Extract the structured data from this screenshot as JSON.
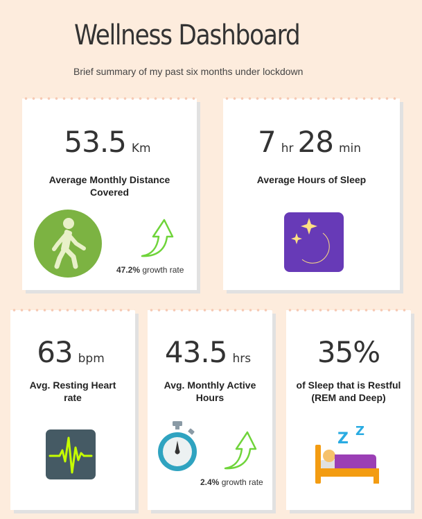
{
  "header": {
    "title": "Wellness Dashboard",
    "subtitle": "Brief summary of my past six months under lockdown"
  },
  "cards": {
    "distance": {
      "value": "53.5",
      "unit": "Km",
      "label": "Average Monthly Distance Covered",
      "growth_value": "47.2%",
      "growth_text": "growth rate",
      "icon": "walking-person-icon"
    },
    "sleep": {
      "value_hr": "7",
      "unit_hr": "hr",
      "value_min": "28",
      "unit_min": "min",
      "label": "Average Hours of Sleep",
      "icon": "moon-stars-icon"
    },
    "heart": {
      "value": "63",
      "unit": "bpm",
      "label": "Avg. Resting Heart rate",
      "icon": "heartbeat-monitor-icon"
    },
    "active": {
      "value": "43.5",
      "unit": "hrs",
      "label": "Avg. Monthly Active Hours",
      "growth_value": "2.4%",
      "growth_text": "growth rate",
      "icon": "stopwatch-icon"
    },
    "restful": {
      "value": "35%",
      "label": "of Sleep that is Restful (REM and Deep)",
      "icon": "sleeping-in-bed-icon"
    }
  },
  "colors": {
    "background": "#fdecdd",
    "arrow_green": "#6fd43a",
    "walk_green": "#7cb342",
    "moon_purple": "#673ab7",
    "moon_yellow": "#ffe082",
    "ecg_bg": "#455a64",
    "ecg_line": "#c6ff00",
    "stopwatch_blue": "#2fa3c0",
    "bed_orange": "#f39c12",
    "blanket_purple": "#9b3fb5",
    "zzz_blue": "#29abe2"
  }
}
